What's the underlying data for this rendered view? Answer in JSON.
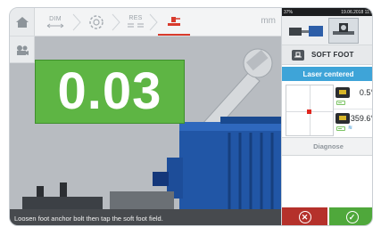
{
  "toolbar": {
    "home_icon": "home-icon",
    "dim_label": "DIM",
    "machine_icon": "machine-gear-icon",
    "res_label": "RES",
    "softfoot_icon": "soft-foot-icon",
    "unit": "mm"
  },
  "sidebar": {
    "camera_icon": "camera-icon"
  },
  "measurement": {
    "value": "0.03",
    "color": "#5eb544"
  },
  "status_message": "Loosen foot anchor bolt then tap the soft foot field.",
  "panel": {
    "battery_percent": "37%",
    "date_time": "19.06.2018 11:5",
    "mode_label": "SOFT FOOT",
    "laser_status": "Laser centered",
    "sensor1_angle": "0.5°",
    "sensor2_angle": "359.6°",
    "diagnose_label": "Diagnose",
    "cancel_icon": "x-circle-icon",
    "ok_icon": "check-circle-icon",
    "accent_color": "#3ea4d8",
    "cancel_color": "#b5312b",
    "ok_color": "#4fa83b"
  }
}
